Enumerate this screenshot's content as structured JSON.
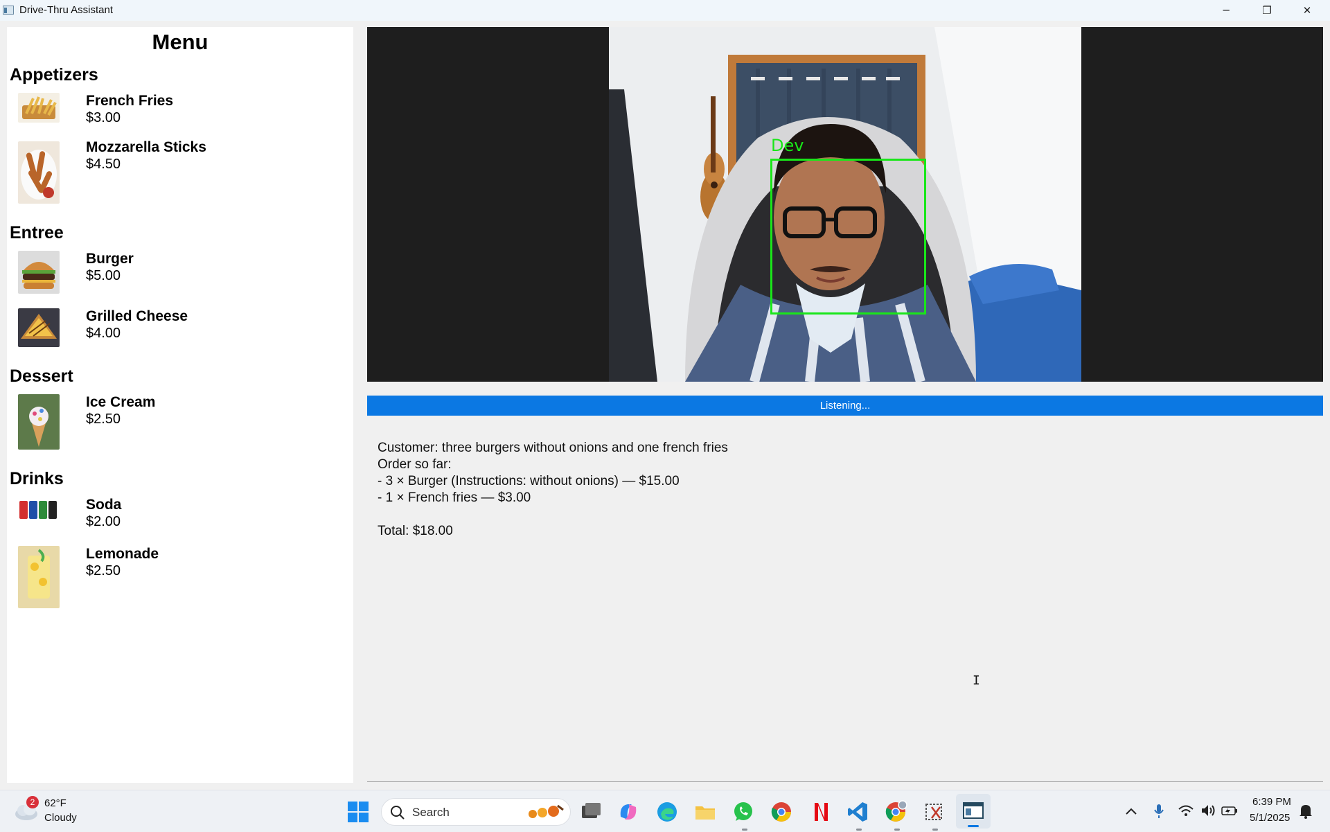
{
  "window": {
    "title": "Drive-Thru Assistant",
    "minimize_glyph": "─",
    "maximize_glyph": "❐",
    "close_glyph": "✕"
  },
  "menu": {
    "title": "Menu",
    "categories": [
      {
        "name": "Appetizers",
        "items": [
          {
            "name": "French Fries",
            "price": "$3.00",
            "image": "french-fries-photo"
          },
          {
            "name": "Mozzarella Sticks",
            "price": "$4.50",
            "image": "mozzarella-sticks-photo"
          }
        ]
      },
      {
        "name": "Entree",
        "items": [
          {
            "name": "Burger",
            "price": "$5.00",
            "image": "burger-photo"
          },
          {
            "name": "Grilled Cheese",
            "price": "$4.00",
            "image": "grilled-cheese-photo"
          }
        ]
      },
      {
        "name": "Dessert",
        "items": [
          {
            "name": "Ice Cream",
            "price": "$2.50",
            "image": "ice-cream-photo"
          }
        ]
      },
      {
        "name": "Drinks",
        "items": [
          {
            "name": "Soda",
            "price": "$2.00",
            "image": "soda-photo"
          },
          {
            "name": "Lemonade",
            "price": "$2.50",
            "image": "lemonade-photo"
          }
        ]
      }
    ]
  },
  "video": {
    "face_label": "Dev",
    "box_color": "#19e619"
  },
  "status": {
    "text": "Listening...",
    "color": "#0b78e3"
  },
  "transcript": {
    "lines": [
      "Customer: three burgers without onions and one french fries",
      "Order so far:",
      "- 3 × Burger (Instructions: without onions) — $15.00",
      "- 1 × French fries — $3.00",
      "",
      "Total: $18.00"
    ]
  },
  "taskbar": {
    "weather_temp": "62°F",
    "weather_desc": "Cloudy",
    "notification_count": "2",
    "search_placeholder": "Search",
    "time": "6:39 PM",
    "date": "5/1/2025",
    "pinned_apps": [
      "start",
      "task-view",
      "copilot",
      "edge",
      "file-explorer",
      "whatsapp",
      "chrome",
      "netflix",
      "vscode",
      "chrome-profile",
      "snipping-tool",
      "drive-thru-assistant"
    ]
  }
}
